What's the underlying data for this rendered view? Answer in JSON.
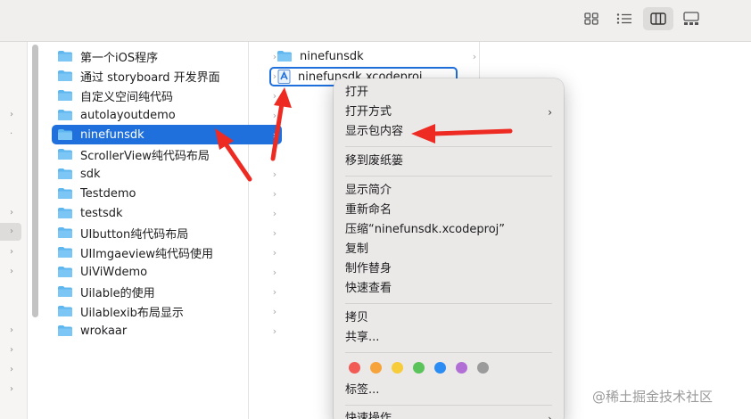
{
  "toolbar": {
    "buttons": [
      {
        "name": "icon-view-button",
        "icon": "grid-icon"
      },
      {
        "name": "list-view-button",
        "icon": "list-icon"
      },
      {
        "name": "column-view-button",
        "icon": "columns-icon",
        "active": true
      },
      {
        "name": "gallery-view-button",
        "icon": "gallery-icon"
      }
    ]
  },
  "column1": {
    "items": [
      "第一个iOS程序",
      "通过 storyboard 开发界面",
      "自定义空间纯代码",
      "autolayoutdemo",
      "ninefunsdk",
      "ScrollerView纯代码布局",
      "sdk",
      "Testdemo",
      "testsdk",
      "UIbutton纯代码布局",
      "UIImgaeview纯代码使用",
      "UiViWdemo",
      "Uilable的使用",
      "Uilablexib布局显示",
      "wrokaar"
    ],
    "selected_index": 4
  },
  "column2": {
    "folder": "ninefunsdk",
    "file": "ninefunsdk.xcodeproj"
  },
  "context_menu": {
    "open": "打开",
    "open_with": "打开方式",
    "show_package_contents": "显示包内容",
    "move_to_trash": "移到废纸篓",
    "get_info": "显示简介",
    "rename": "重新命名",
    "compress": "压缩“ninefunsdk.xcodeproj”",
    "duplicate": "复制",
    "make_alias": "制作替身",
    "quick_look": "快速查看",
    "copy": "拷贝",
    "share": "共享...",
    "tag_colors": [
      "#f25a55",
      "#f6a33b",
      "#f6cc3b",
      "#5ac35a",
      "#2b8cf4",
      "#b16fd6",
      "#9b9b9b"
    ],
    "tags": "标签...",
    "quick_actions": "快速操作"
  },
  "colors": {
    "selection": "#1f6fdc",
    "folder": "#5fb7f0",
    "arrow": "#ee2b22"
  },
  "watermark": "@稀土掘金技术社区"
}
